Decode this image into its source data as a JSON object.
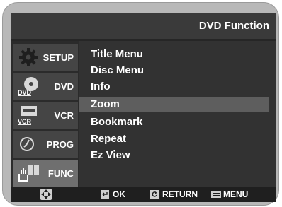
{
  "header": {
    "title": "DVD Function"
  },
  "sidebar": {
    "items": [
      {
        "label": "SETUP",
        "icon": "gear-icon",
        "active": false
      },
      {
        "label": "DVD",
        "icon": "dvd-disc-icon",
        "active": false
      },
      {
        "label": "VCR",
        "icon": "vcr-icon",
        "active": false
      },
      {
        "label": "PROG",
        "icon": "clock-icon",
        "active": false
      },
      {
        "label": "FUNC",
        "icon": "hand-icon",
        "active": true
      }
    ]
  },
  "menu": {
    "items": [
      {
        "label": "Title Menu"
      },
      {
        "label": "Disc Menu"
      },
      {
        "label": "Info"
      },
      {
        "label": "Zoom"
      },
      {
        "label": "Bookmark"
      },
      {
        "label": "Repeat"
      },
      {
        "label": "Ez View"
      }
    ],
    "selected": "Zoom"
  },
  "footer": {
    "nav_icon": "dpad-icon",
    "ok_label": "OK",
    "return_label": "RETURN",
    "menu_label": "MENU"
  },
  "colors": {
    "frame": "#b8b8b8",
    "screen": "#333333",
    "highlight": "#5e5e5e",
    "text": "#ffffff"
  }
}
